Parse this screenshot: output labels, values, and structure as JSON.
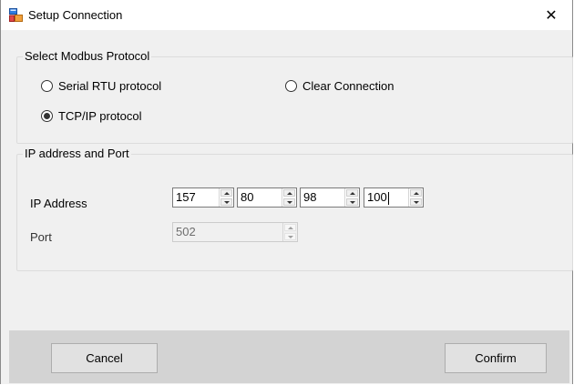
{
  "window": {
    "title": "Setup Connection",
    "icon": "app-window-icon",
    "close_glyph": "✕"
  },
  "protocol_group": {
    "title": "Select Modbus Protocol",
    "options": [
      {
        "label": "Serial RTU protocol",
        "checked": false
      },
      {
        "label": "Clear Connection",
        "checked": false
      },
      {
        "label": "TCP/IP protocol",
        "checked": true
      }
    ]
  },
  "ip_group": {
    "title": "IP address and Port",
    "ip_label": "IP Address",
    "octets": [
      "157",
      "80",
      "98",
      "100"
    ],
    "port_label": "Port",
    "port_value": "502",
    "port_enabled": false
  },
  "buttons": {
    "cancel": "Cancel",
    "confirm": "Confirm"
  },
  "colors": {
    "window_bg": "#f0f0f0",
    "bottom_panel": "#d3d3d3",
    "button_bg": "#e1e1e1"
  }
}
